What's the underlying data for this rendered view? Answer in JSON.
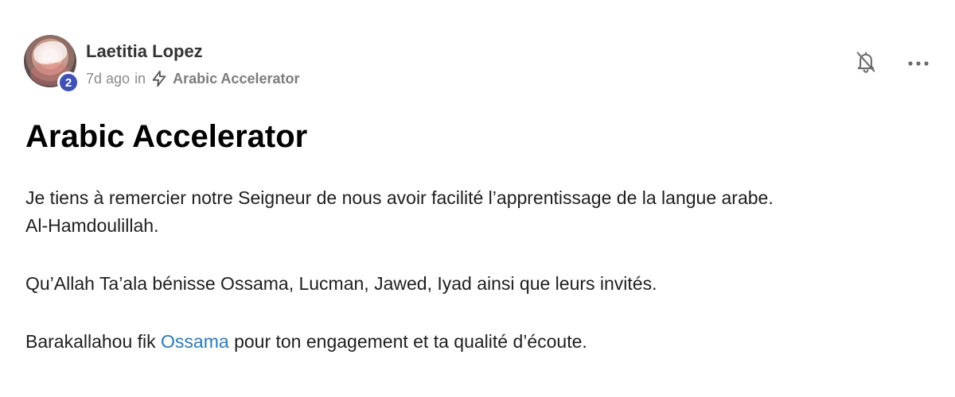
{
  "post": {
    "author": {
      "name": "Laetitia Lopez",
      "level": "2"
    },
    "meta": {
      "time_ago": "7d ago",
      "in_label": "in",
      "space_icon": "bolt-icon",
      "space_name": "Arabic Accelerator"
    },
    "actions": {
      "notify_icon": "bell-off-icon",
      "more_icon": "more-horizontal-icon"
    },
    "title": "Arabic Accelerator",
    "body": {
      "paragraph1_line1": "Je tiens à remercier notre Seigneur de nous avoir facilité l’apprentissage de la langue arabe.",
      "paragraph1_line2": "Al-Hamdoulillah.",
      "paragraph2": "Qu’Allah Ta’ala bénisse Ossama, Lucman, Jawed, Iyad ainsi que leurs invités.",
      "paragraph3_before": "Barakallahou fik ",
      "paragraph3_mention": "Ossama",
      "paragraph3_after": " pour ton engagement et ta qualité d’écoute."
    }
  },
  "colors": {
    "mention": "#2a7ab8",
    "level_badge": "#3f51b5",
    "meta_text": "#8a8a8a"
  }
}
